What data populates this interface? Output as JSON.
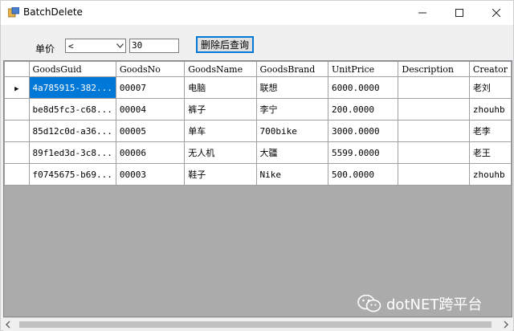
{
  "window": {
    "title": "BatchDelete",
    "minimize": "—",
    "maximize": "☐",
    "close": "✕"
  },
  "filter": {
    "price_label": "单价",
    "operator_value": "<",
    "value": "30",
    "query_button": "删除后查询"
  },
  "grid": {
    "columns": [
      "GoodsGuid",
      "GoodsNo",
      "GoodsName",
      "GoodsBrand",
      "UnitPrice",
      "Description",
      "Creator"
    ],
    "rows": [
      [
        "4a785915-382...",
        "00007",
        "电脑",
        "联想",
        "6000.0000",
        "",
        "老刘"
      ],
      [
        "be8d5fc3-c68...",
        "00004",
        "裤子",
        "李宁",
        "200.0000",
        "",
        "zhouhb"
      ],
      [
        "85d12c0d-a36...",
        "00005",
        "单车",
        "700bike",
        "3000.0000",
        "",
        "老李"
      ],
      [
        "89f1ed3d-3c8...",
        "00006",
        "无人机",
        "大疆",
        "5599.0000",
        "",
        "老王"
      ],
      [
        "f0745675-b69...",
        "00003",
        "鞋子",
        "Nike",
        "500.0000",
        "",
        "zhouhb"
      ]
    ],
    "current_row_marker": "▶"
  },
  "watermark": {
    "text": "dotNET跨平台",
    "icon": "wechat-icon"
  }
}
